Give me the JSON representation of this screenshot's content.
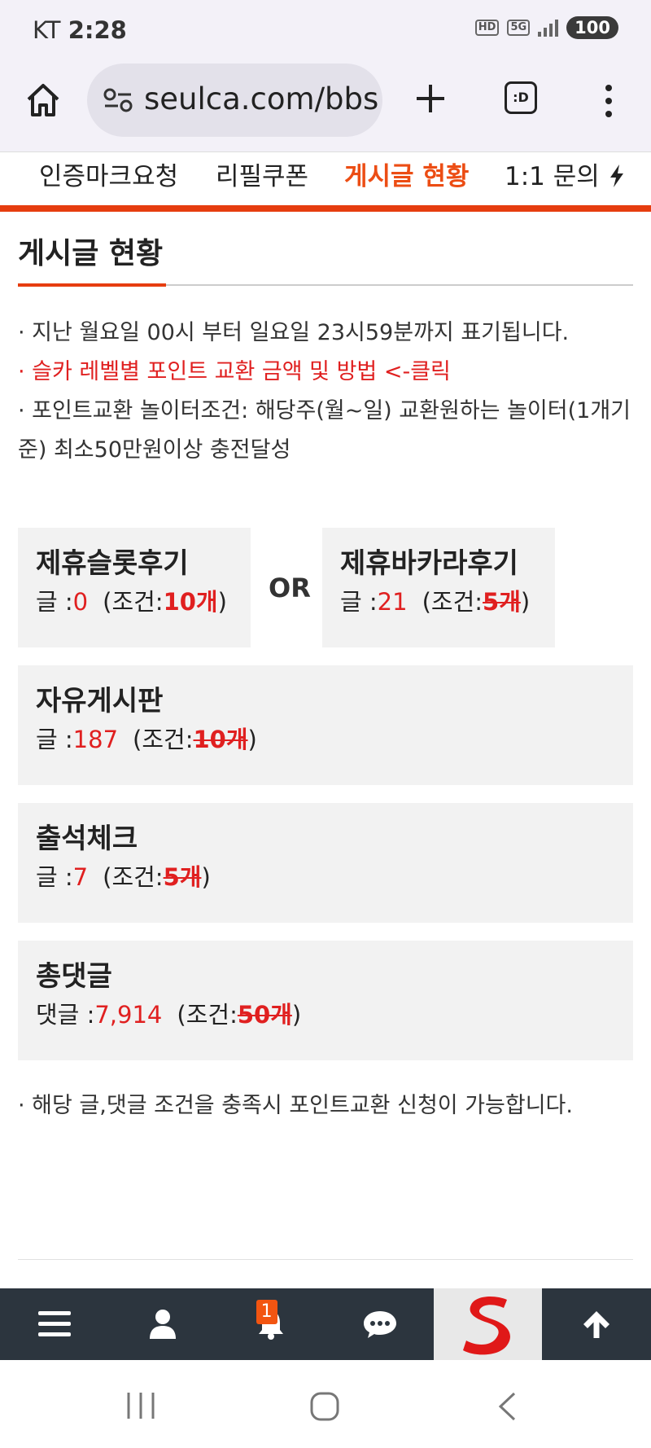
{
  "status_bar": {
    "carrier": "KT",
    "time": "2:28",
    "hd_label": "HD",
    "network_label": "5G",
    "battery": "100"
  },
  "browser": {
    "url": "seulca.com/bbs",
    "tabs_label": ":D"
  },
  "subnav": {
    "items": [
      {
        "label": "인증마크요청"
      },
      {
        "label": "리필쿠폰"
      },
      {
        "label": "게시글 현황"
      },
      {
        "label": "1:1 문의"
      }
    ]
  },
  "page": {
    "title": "게시글 현황",
    "notes": [
      "· 지난 월요일 00시 부터 일요일 23시59분까지 표기됩니다.",
      "· 슬카 레벨별 포인트 교환 금액 및 방법 <-클릭",
      "· 포인트교환 놀이터조건: 해당주(월~일) 교환원하는 놀이터(1개기준) 최소50만원이상 충전달성"
    ],
    "or_label": "OR",
    "footer_note": "· 해당 글,댓글 조건을 충족시 포인트교환 신청이 가능합니다."
  },
  "cards": [
    {
      "title": "제휴슬롯후기",
      "prefix": "글 :",
      "count": "0",
      "cond_label": "(조건:",
      "cond_value": "10개",
      "cond_close": ")"
    },
    {
      "title": "제휴바카라후기",
      "prefix": "글 :",
      "count": "21",
      "cond_label": "(조건:",
      "cond_value": "5개",
      "cond_close": ")"
    },
    {
      "title": "자유게시판",
      "prefix": "글 :",
      "count": "187",
      "cond_label": "(조건:",
      "cond_value": "10개",
      "cond_close": ")"
    },
    {
      "title": "출석체크",
      "prefix": "글 :",
      "count": "7",
      "cond_label": "(조건:",
      "cond_value": "5개",
      "cond_close": ")"
    },
    {
      "title": "총댓글",
      "prefix": "댓글 :",
      "count": "7,914",
      "cond_label": "(조건:",
      "cond_value": "50개",
      "cond_close": ")"
    }
  ],
  "toolbar": {
    "notification_count": "1",
    "icons": [
      "menu-icon",
      "user-icon",
      "bell-icon",
      "chat-icon",
      "site-logo",
      "arrow-up-icon"
    ]
  },
  "colors": {
    "accent": "#e63d0f",
    "red": "#e02020",
    "toolbar_bg": "#2c353e"
  }
}
